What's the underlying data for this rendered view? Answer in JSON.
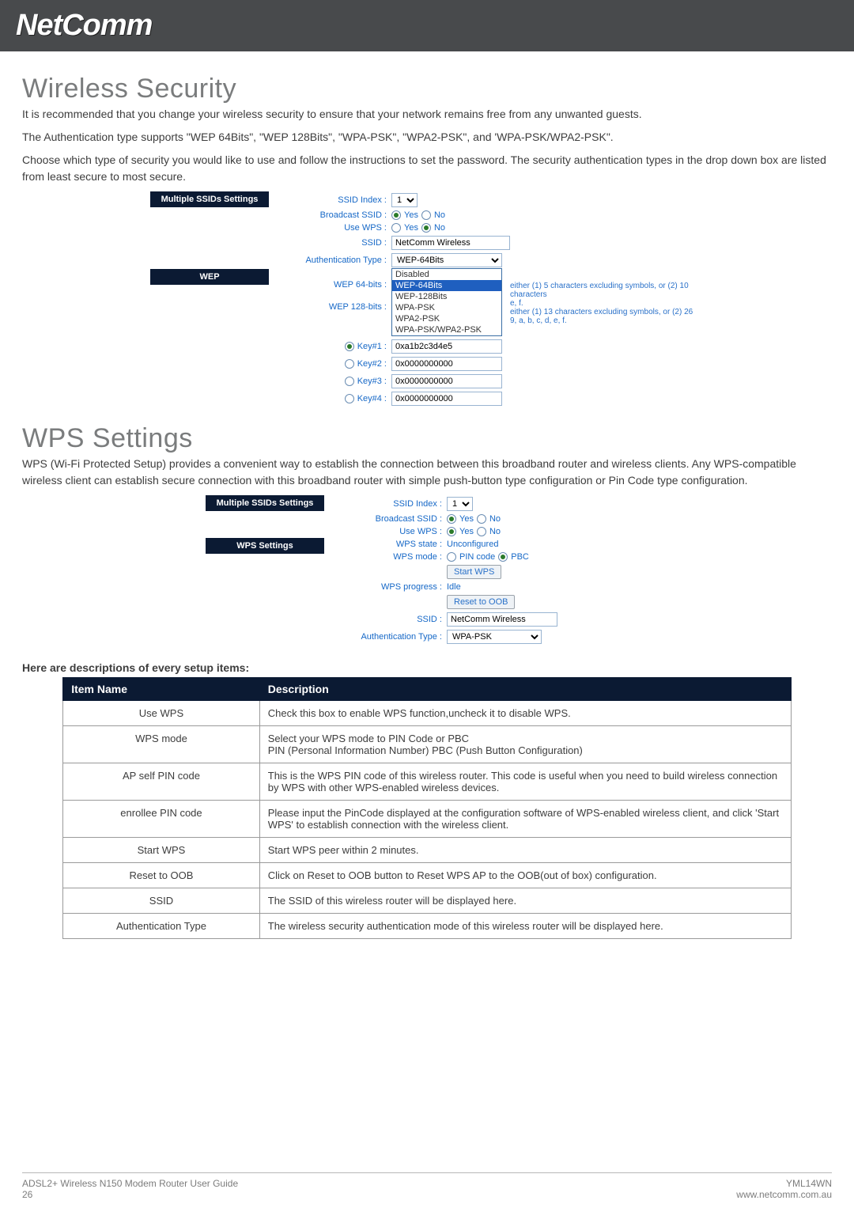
{
  "logo": "NetComm",
  "sections": {
    "wireless": {
      "title": "Wireless Security",
      "para1": "It is recommended that you change your wireless security to ensure that your network remains free from any unwanted guests.",
      "para2": "The Authentication type supports \"WEP 64Bits\", \"WEP 128Bits\", \"WPA-PSK\", \"WPA2-PSK\", and 'WPA-PSK/WPA2-PSK\".",
      "para3": "Choose which type of security you would like to use and follow the instructions to set the password. The security authentication types in the drop down box are listed from least secure to most secure."
    },
    "wps": {
      "title": "WPS Settings",
      "para1": "WPS (Wi-Fi Protected Setup) provides a convenient way to establish the connection between this broadband router and wireless clients. Any WPS-compatible wireless client can establish secure connection with this broadband router with simple push-button type configuration or Pin Code type configuration."
    }
  },
  "panel1": {
    "header": "Multiple SSIDs Settings",
    "sidebarLabel": "WEP",
    "labels": {
      "ssidIndex": "SSID Index :",
      "broadcastSsid": "Broadcast SSID :",
      "useWps": "Use WPS :",
      "ssid": "SSID :",
      "authType": "Authentication Type :",
      "wep64": "WEP 64-bits :",
      "wep128": "WEP 128-bits :",
      "key1": "Key#1 :",
      "key2": "Key#2 :",
      "key3": "Key#3 :",
      "key4": "Key#4 :"
    },
    "values": {
      "ssidIndex": "1",
      "yes": "Yes",
      "no": "No",
      "ssid": "NetComm Wireless",
      "authType": "WEP-64Bits",
      "dropdownOptions": [
        "Disabled",
        "WEP-64Bits",
        "WEP-128Bits",
        "WPA-PSK",
        "WPA2-PSK",
        "WPA-PSK/WPA2-PSK"
      ],
      "hint64a": "either (1) 5 characters excluding symbols, or (2) 10 characters",
      "hint64b": "e, f.",
      "hint128a": "either (1) 13 characters excluding symbols, or (2) 26",
      "hint128b": "9, a, b, c, d, e, f.",
      "key1": "0xa1b2c3d4e5",
      "key2": "0x0000000000",
      "key3": "0x0000000000",
      "key4": "0x0000000000"
    }
  },
  "panel2": {
    "header": "Multiple SSIDs Settings",
    "header2": "WPS Settings",
    "labels": {
      "ssidIndex": "SSID Index :",
      "broadcastSsid": "Broadcast SSID :",
      "useWps": "Use WPS :",
      "wpsState": "WPS state :",
      "wpsMode": "WPS mode :",
      "wpsProgress": "WPS progress :",
      "ssid": "SSID :",
      "authType": "Authentication Type :"
    },
    "values": {
      "ssidIndex": "1",
      "yes": "Yes",
      "no": "No",
      "wpsState": "Unconfigured",
      "pinCode": "PIN code",
      "pbc": "PBC",
      "startWps": "Start WPS",
      "wpsProgress": "Idle",
      "resetOob": "Reset to OOB",
      "ssid": "NetComm Wireless",
      "authType": "WPA-PSK"
    }
  },
  "tableIntro": "Here are descriptions of every setup items:",
  "table": {
    "head1": "Item Name",
    "head2": "Description",
    "rows": [
      {
        "name": "Use WPS",
        "desc": "Check this box to enable WPS function,uncheck it to disable WPS."
      },
      {
        "name": "WPS mode",
        "desc": "Select your WPS mode to PIN Code or PBC\nPIN (Personal Information Number) PBC (Push Button Configuration)"
      },
      {
        "name": "AP self PIN code",
        "desc": "This is the WPS PIN code of this wireless router. This code is useful when you need to build wireless connection by WPS with other WPS-enabled wireless devices."
      },
      {
        "name": "enrollee PIN code",
        "desc": "Please input the PinCode displayed at the configuration software of WPS-enabled wireless client, and click 'Start WPS' to establish connection with the wireless client."
      },
      {
        "name": "Start WPS",
        "desc": "Start WPS peer within 2 minutes."
      },
      {
        "name": "Reset to OOB",
        "desc": "Click on Reset to OOB button to Reset WPS AP to the OOB(out of box) configuration."
      },
      {
        "name": "SSID",
        "desc": "The SSID of this wireless router will be displayed here."
      },
      {
        "name": "Authentication Type",
        "desc": "The wireless security authentication mode of this wireless router will be displayed here."
      }
    ]
  },
  "footer": {
    "leftTop": "ADSL2+ Wireless N150 Modem Router User Guide",
    "leftBottom": "26",
    "rightTop": "YML14WN",
    "rightBottom": "www.netcomm.com.au"
  }
}
